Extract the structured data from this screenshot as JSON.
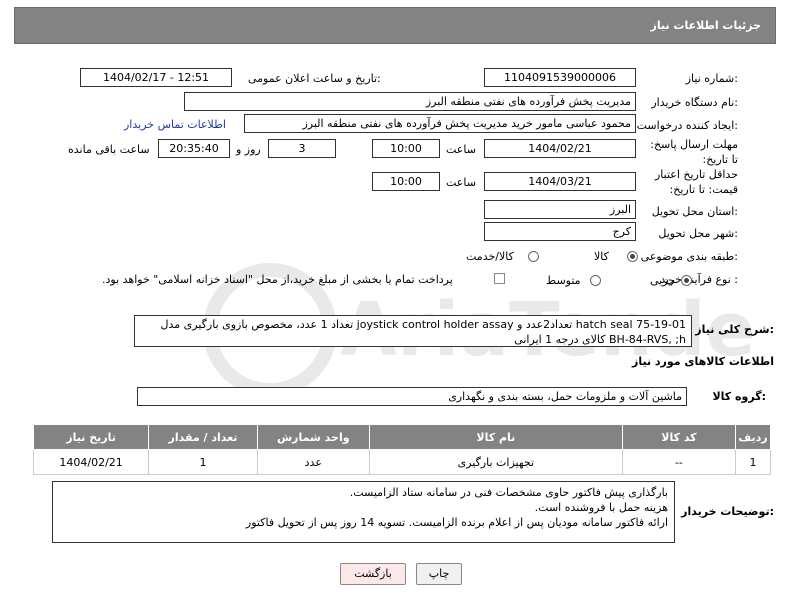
{
  "header": {
    "title": "جزئیات اطلاعات نیاز"
  },
  "form": {
    "need_number_label": "شماره نیاز:",
    "need_number": "1104091539000006",
    "announce_label": "تاریخ و ساعت اعلان عمومی:",
    "announce_value": "1404/02/17 - 12:51",
    "buyer_org_label": "نام دستگاه خریدار:",
    "buyer_org": "مدیریت پخش فرآورده های نفتی منطقه البرز",
    "creator_label": "ایجاد کننده درخواست:",
    "creator": "محمود عباسی مامور خرید  مدیریت پخش فرآورده های نفتی منطقه البرز",
    "contact_link": "اطلاعات تماس خریدار",
    "deadline_label": "مهلت ارسال پاسخ: تا تاریخ:",
    "deadline_date": "1404/02/21",
    "time_label": "ساعت",
    "deadline_time": "10:00",
    "days_value": "3",
    "days_label": "روز و",
    "remaining_time": "20:35:40",
    "remaining_label": "ساعت باقی مانده",
    "validity_label": "حداقل تاریخ اعتبار قیمت: تا تاریخ:",
    "validity_date": "1404/03/21",
    "validity_time_label": "ساعت",
    "validity_time": "10:00",
    "province_label": "استان محل تحویل:",
    "province": "البرز",
    "city_label": "شهر محل تحویل:",
    "city": "کرج",
    "category_label": "طبقه بندی موضوعی:",
    "category_options": [
      "کالا",
      "کالا/خدمت"
    ],
    "process_label": "نوع فرآیند خرید :",
    "process_options": [
      "جزیی",
      "متوسط"
    ],
    "payment_note": "پرداخت تمام یا بخشی از مبلغ خرید،از محل \"اسناد خزانه اسلامی\" خواهد بود."
  },
  "description": {
    "label": "شرح کلی نیاز:",
    "line1": "hatch seal 75-19-01 تعداد2عدد و joystick control holder assay تعداد 1 عدد، مخصوص بازوی بارگیری مدل",
    "line2": "BH-84-RVS, ;h کالای درجه 1 ایرانی"
  },
  "goods_info": {
    "title": "اطلاعات کالاهای مورد نیاز",
    "group_label": "گروه کالا:",
    "group_value": "ماشین آلات و ملزومات حمل، بسته بندی و نگهداری"
  },
  "table": {
    "headers": [
      "ردیف",
      "کد کالا",
      "نام کالا",
      "واحد شمارش",
      "تعداد / مقدار",
      "تاریخ نیاز"
    ],
    "rows": [
      [
        "1",
        "--",
        "تجهیزات بارگیری",
        "عدد",
        "1",
        "1404/02/21"
      ]
    ]
  },
  "buyer_notes": {
    "label": "توضیحات خریدار:",
    "line1": "بارگذاری پیش فاکتور حاوی مشخصات فنی در سامانه ستاد الزامیست.",
    "line2": "هزینه حمل با فروشنده است.",
    "line3": "ارائه فاکتور سامانه مودیان پس از اعلام برنده الزامیست. تسویه 14 روز پس از تحویل فاکتور"
  },
  "buttons": {
    "print": "چاپ",
    "back": "بازگشت"
  },
  "watermark": {
    "text": "AriaTender.neT"
  },
  "colors": {
    "header_bg": "#838383",
    "link": "#1a3c9c",
    "back_button_bg": "#fde8e8"
  }
}
